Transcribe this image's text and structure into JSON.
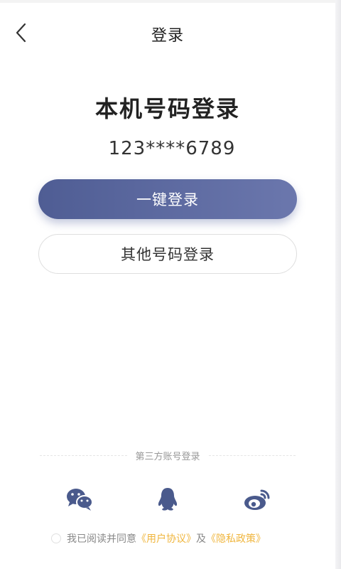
{
  "nav": {
    "title": "登录",
    "back_icon": "chevron-left-icon"
  },
  "main": {
    "heading": "本机号码登录",
    "masked_phone": "123****6789",
    "one_click_login_label": "一键登录",
    "other_number_login_label": "其他号码登录"
  },
  "third_party": {
    "divider_text": "第三方账号登录",
    "providers": [
      {
        "name": "wechat",
        "icon": "wechat-icon"
      },
      {
        "name": "qq",
        "icon": "qq-penguin-icon"
      },
      {
        "name": "weibo",
        "icon": "weibo-icon"
      }
    ]
  },
  "agreement": {
    "prefix": "我已阅读并同意",
    "user_agreement": "《用户协议》",
    "conjunction": "及",
    "privacy_policy": "《隐私政策》"
  },
  "colors": {
    "primary_gradient_start": "#4f5d94",
    "primary_gradient_end": "#6b77ad",
    "icon_color": "#4a5a8c",
    "link_color": "#f0b63e"
  }
}
